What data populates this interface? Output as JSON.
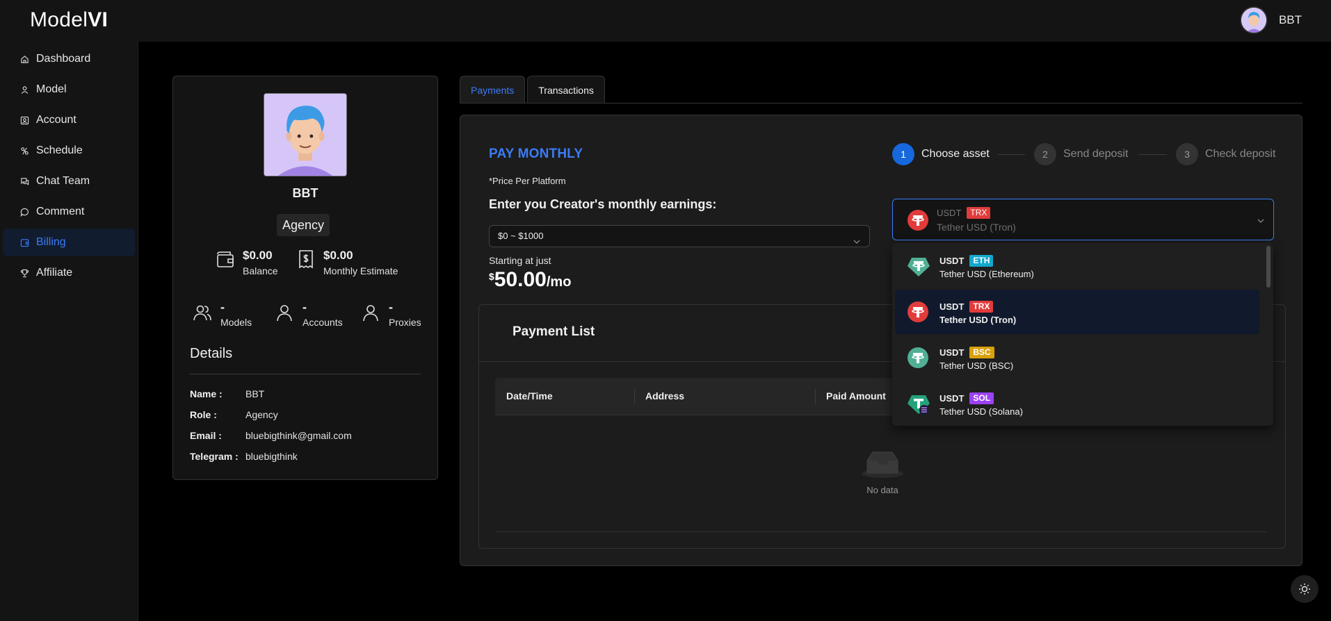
{
  "app": {
    "logo_regular": "Model",
    "logo_bold": "VI"
  },
  "user": {
    "name": "BBT"
  },
  "sidebar": {
    "items": [
      {
        "label": "Dashboard",
        "icon": "home-icon"
      },
      {
        "label": "Model",
        "icon": "user-icon"
      },
      {
        "label": "Account",
        "icon": "account-icon"
      },
      {
        "label": "Schedule",
        "icon": "schedule-icon"
      },
      {
        "label": "Chat Team",
        "icon": "chat-icon"
      },
      {
        "label": "Comment",
        "icon": "comment-icon"
      },
      {
        "label": "Billing",
        "icon": "billing-icon",
        "active": true
      },
      {
        "label": "Affiliate",
        "icon": "trophy-icon"
      }
    ]
  },
  "profile": {
    "name": "BBT",
    "role_tag": "Agency",
    "balance": {
      "value": "$0.00",
      "label": "Balance"
    },
    "monthly_estimate": {
      "value": "$0.00",
      "label": "Monthly Estimate"
    },
    "models": {
      "value": "-",
      "label": "Models"
    },
    "accounts": {
      "value": "-",
      "label": "Accounts"
    },
    "proxies": {
      "value": "-",
      "label": "Proxies"
    },
    "details_title": "Details",
    "details": [
      {
        "key": "Name :",
        "value": "BBT"
      },
      {
        "key": "Role :",
        "value": "Agency"
      },
      {
        "key": "Email :",
        "value": "bluebigthink@gmail.com"
      },
      {
        "key": "Telegram :",
        "value": "bluebigthink"
      }
    ]
  },
  "tabs": [
    {
      "label": "Payments",
      "active": true
    },
    {
      "label": "Transactions",
      "active": false
    }
  ],
  "payment": {
    "title": "PAY MONTHLY",
    "price_note": "*Price Per Platform",
    "earnings_label": "Enter you Creator's monthly earnings:",
    "earnings_value": "$0 ~ $1000",
    "starting_label": "Starting at just",
    "price_currency": "$",
    "price_amount": "50.00",
    "price_period": "/mo",
    "steps": [
      {
        "num": "1",
        "label": "Choose asset",
        "active": true
      },
      {
        "num": "2",
        "label": "Send deposit",
        "active": false
      },
      {
        "num": "3",
        "label": "Check deposit",
        "active": false
      }
    ],
    "selected_asset": {
      "symbol": "USDT",
      "network": "TRX",
      "name": "Tether USD (Tron)"
    }
  },
  "asset_options": [
    {
      "symbol": "USDT",
      "network": "ETH",
      "name": "Tether USD (Ethereum)",
      "color": "#50af95"
    },
    {
      "symbol": "USDT",
      "network": "TRX",
      "name": "Tether USD (Tron)",
      "color": "#e23b3b",
      "selected": true
    },
    {
      "symbol": "USDT",
      "network": "BSC",
      "name": "Tether USD (BSC)",
      "color": "#50af95"
    },
    {
      "symbol": "USDT",
      "network": "SOL",
      "name": "Tether USD (Solana)",
      "color": "#26a17b"
    }
  ],
  "payment_list": {
    "title": "Payment List",
    "columns": [
      "Date/Time",
      "Address",
      "Paid Amount"
    ],
    "empty_text": "No data"
  },
  "colors": {
    "accent": "#3b7cf6",
    "background": "#000000",
    "panel": "#141414"
  }
}
